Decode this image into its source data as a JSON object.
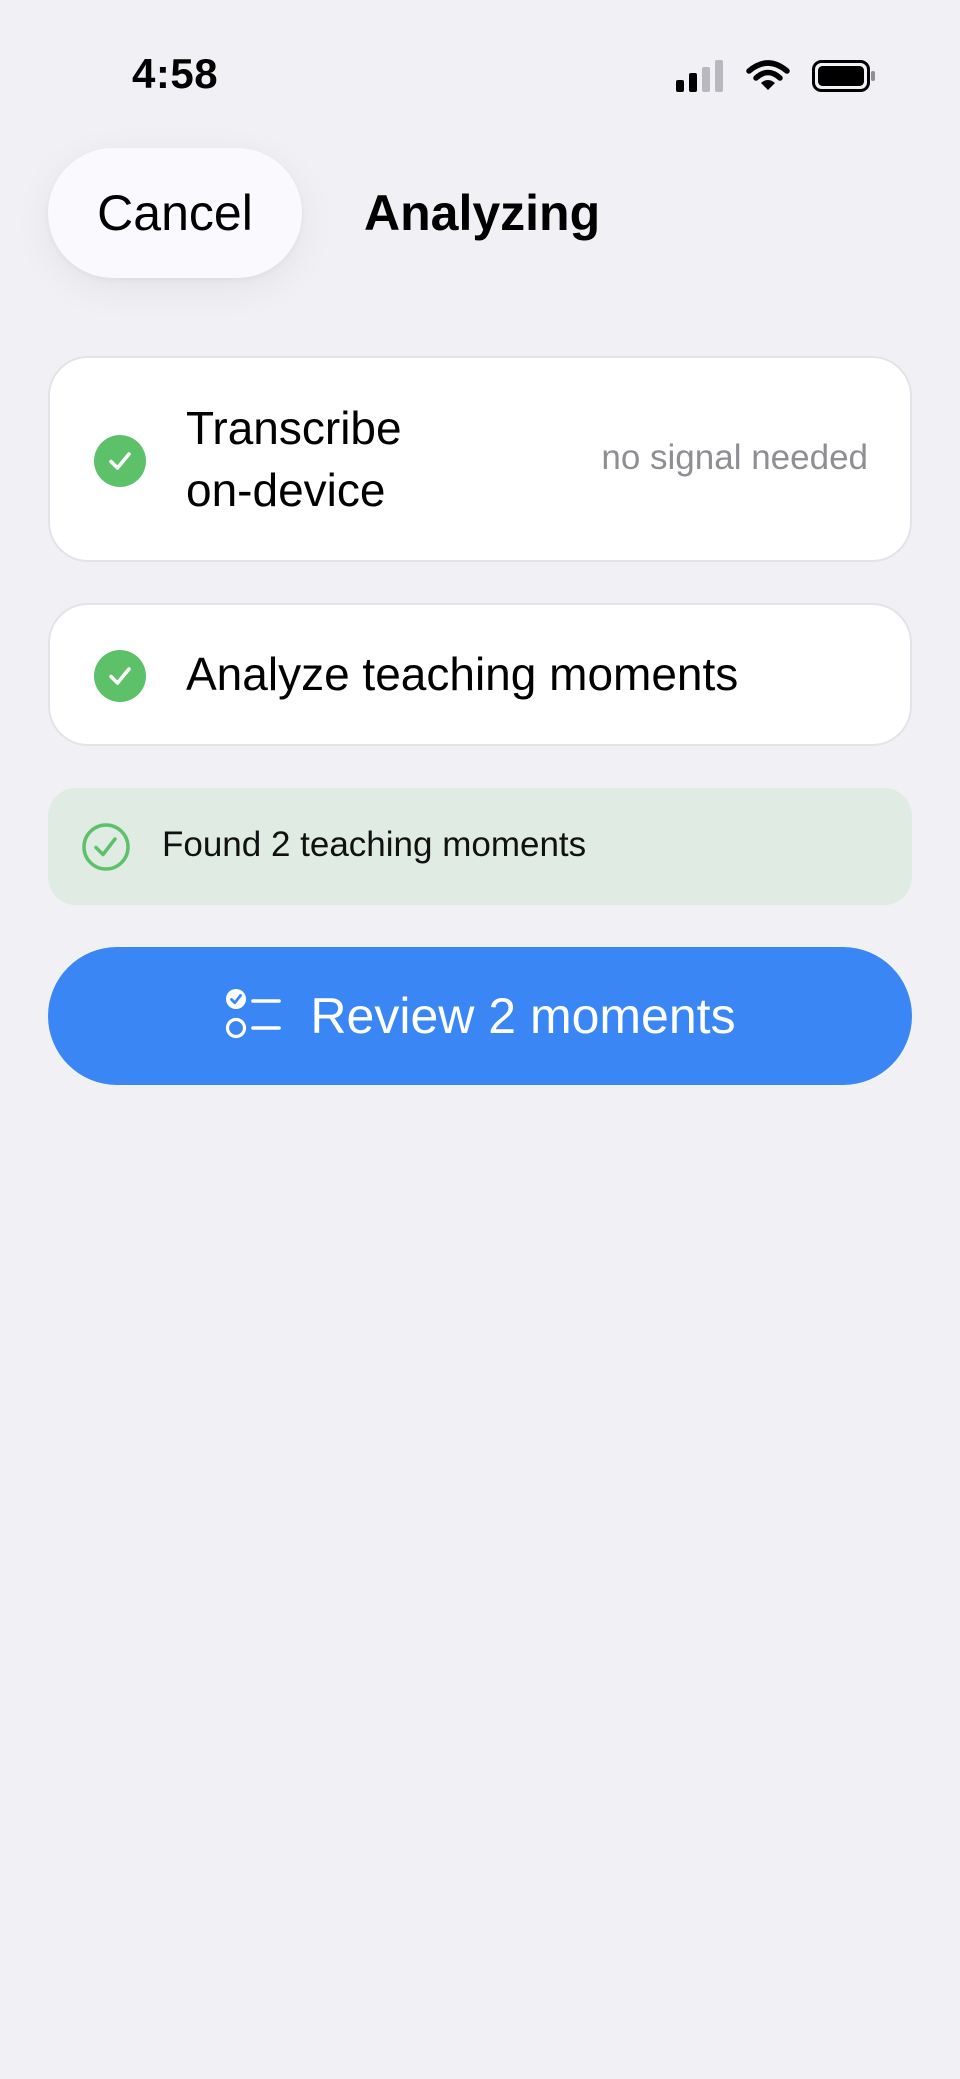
{
  "status_bar": {
    "time": "4:58",
    "icons": [
      "cellular-signal-icon",
      "wifi-icon",
      "battery-icon"
    ]
  },
  "header": {
    "cancel_label": "Cancel",
    "title": "Analyzing"
  },
  "steps": [
    {
      "label": "Transcribe on-device",
      "note": "no signal needed",
      "status": "done",
      "icon": "checkmark-circle-icon"
    },
    {
      "label": "Analyze teaching moments",
      "status": "done",
      "icon": "checkmark-circle-icon"
    }
  ],
  "result": {
    "text": "Found 2 teaching moments",
    "icon": "checkmark-circle-outline-icon"
  },
  "primary_action": {
    "label": "Review 2 moments",
    "icon": "checklist-icon"
  },
  "colors": {
    "background": "#F0F0F5",
    "success_green": "#5DC16A",
    "result_banner_bg": "#DFEBE3",
    "accent_blue": "#3B86F5",
    "secondary_text": "#8E8E93"
  }
}
